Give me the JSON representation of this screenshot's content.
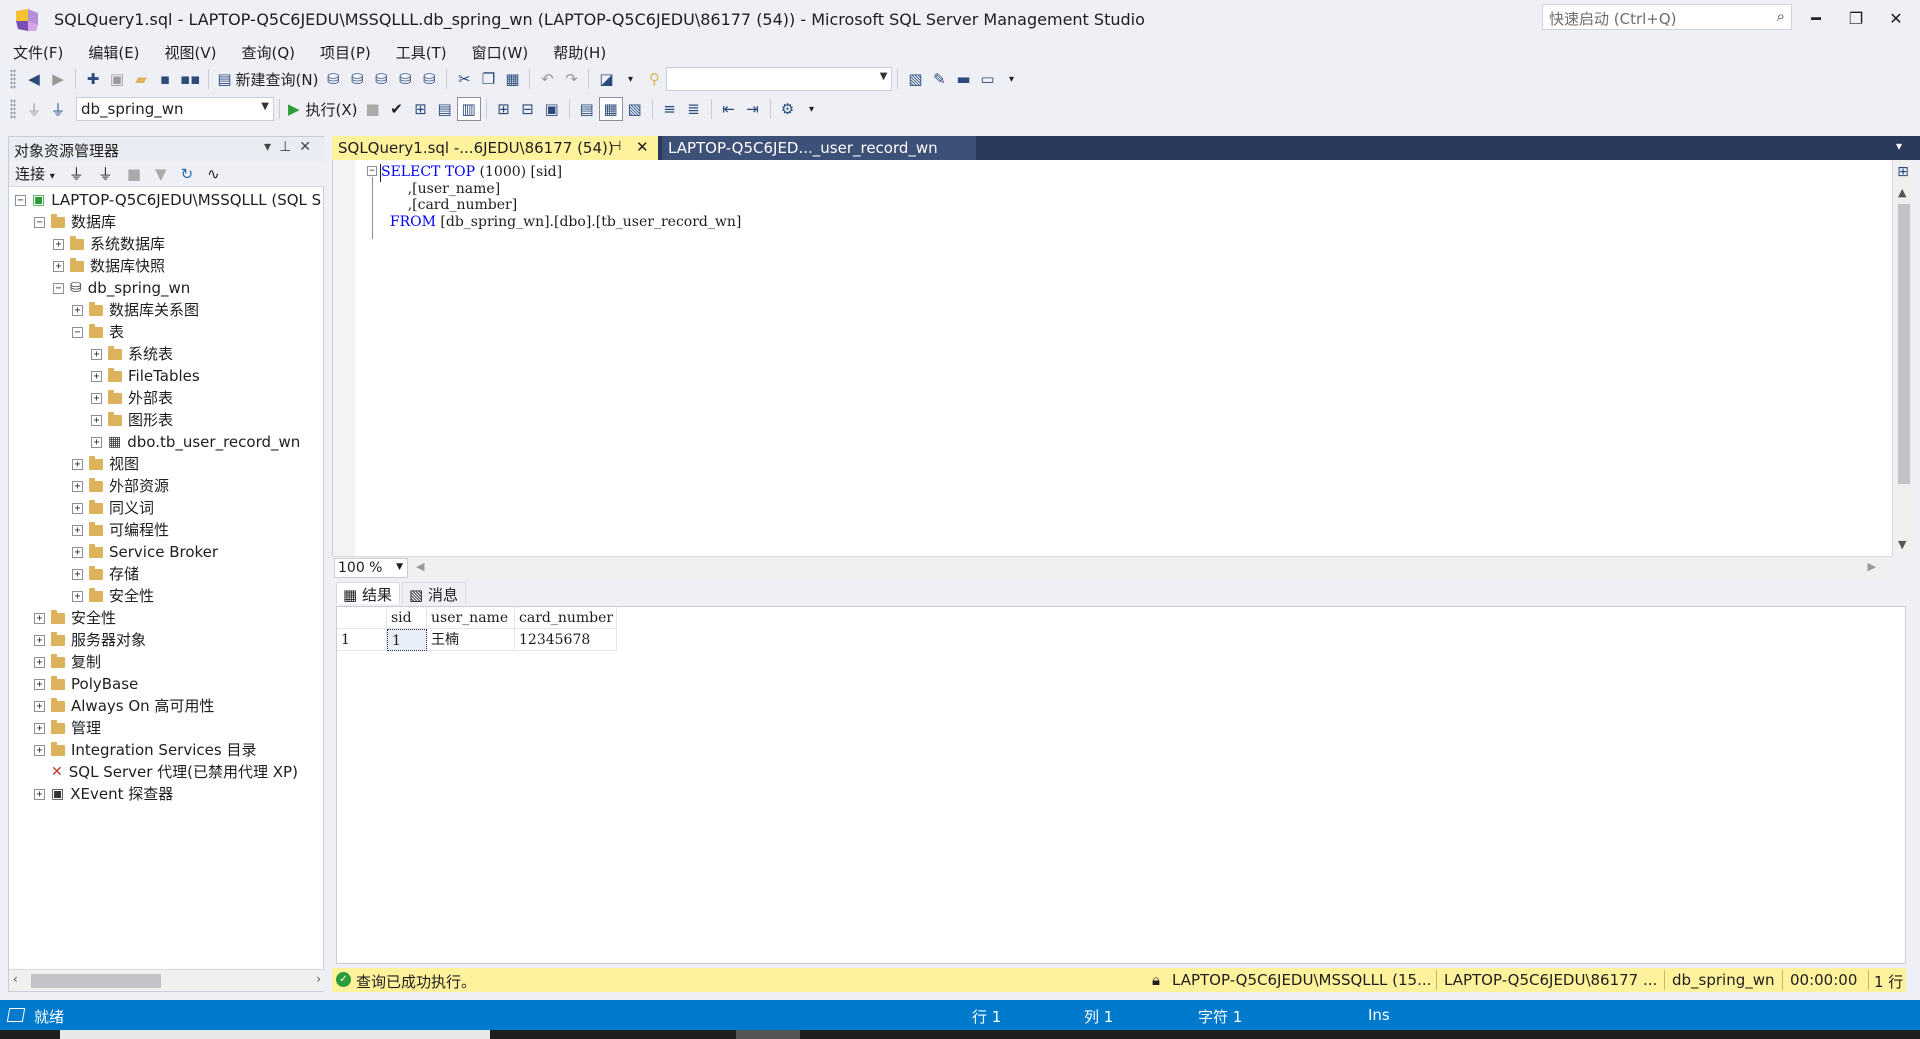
{
  "window": {
    "title": "SQLQuery1.sql - LAPTOP-Q5C6JEDU\\MSSQLLL.db_spring_wn (LAPTOP-Q5C6JEDU\\86177 (54)) - Microsoft SQL Server Management Studio",
    "quick_launch_placeholder": "快速启动 (Ctrl+Q)",
    "minimize": "━",
    "maximize": "❐",
    "close": "✕"
  },
  "menu": [
    "文件(F)",
    "编辑(E)",
    "视图(V)",
    "查询(Q)",
    "项目(P)",
    "工具(T)",
    "窗口(W)",
    "帮助(H)"
  ],
  "toolbar": {
    "new_query": "新建查询(N)",
    "execute": "执行(X)",
    "database": "db_spring_wn"
  },
  "object_explorer": {
    "title": "对象资源管理器",
    "connect": "连接",
    "nodes": [
      {
        "label": "LAPTOP-Q5C6JEDU\\MSSQLLL (SQL S",
        "exp": "−",
        "icon": "server"
      },
      {
        "label": "数据库",
        "exp": "−",
        "icon": "folder"
      },
      {
        "label": "系统数据库",
        "exp": "+",
        "icon": "folder"
      },
      {
        "label": "数据库快照",
        "exp": "+",
        "icon": "folder"
      },
      {
        "label": "db_spring_wn",
        "exp": "−",
        "icon": "database"
      },
      {
        "label": "数据库关系图",
        "exp": "+",
        "icon": "folder"
      },
      {
        "label": "表",
        "exp": "−",
        "icon": "folder"
      },
      {
        "label": "系统表",
        "exp": "+",
        "icon": "folder"
      },
      {
        "label": "FileTables",
        "exp": "+",
        "icon": "folder"
      },
      {
        "label": "外部表",
        "exp": "+",
        "icon": "folder"
      },
      {
        "label": "图形表",
        "exp": "+",
        "icon": "folder"
      },
      {
        "label": "dbo.tb_user_record_wn",
        "exp": "+",
        "icon": "table"
      },
      {
        "label": "视图",
        "exp": "+",
        "icon": "folder"
      },
      {
        "label": "外部资源",
        "exp": "+",
        "icon": "folder"
      },
      {
        "label": "同义词",
        "exp": "+",
        "icon": "folder"
      },
      {
        "label": "可编程性",
        "exp": "+",
        "icon": "folder"
      },
      {
        "label": "Service Broker",
        "exp": "+",
        "icon": "folder"
      },
      {
        "label": "存储",
        "exp": "+",
        "icon": "folder"
      },
      {
        "label": "安全性",
        "exp": "+",
        "icon": "folder"
      },
      {
        "label": "安全性",
        "exp": "+",
        "icon": "folder"
      },
      {
        "label": "服务器对象",
        "exp": "+",
        "icon": "folder"
      },
      {
        "label": "复制",
        "exp": "+",
        "icon": "folder"
      },
      {
        "label": "PolyBase",
        "exp": "+",
        "icon": "folder"
      },
      {
        "label": "Always On 高可用性",
        "exp": "+",
        "icon": "folder"
      },
      {
        "label": "管理",
        "exp": "+",
        "icon": "folder"
      },
      {
        "label": "Integration Services 目录",
        "exp": "+",
        "icon": "folder"
      },
      {
        "label": "SQL Server 代理(已禁用代理 XP)",
        "exp": "",
        "icon": "agent"
      },
      {
        "label": "XEvent 探查器",
        "exp": "+",
        "icon": "xevent"
      }
    ]
  },
  "tabs": {
    "active": "SQLQuery1.sql -...6JEDU\\86177 (54))",
    "inactive": "LAPTOP-Q5C6JED..._user_record_wn"
  },
  "editor": {
    "lines": [
      {
        "kw1": "SELECT",
        "sp1": " ",
        "kw2": "TOP",
        "rest": " (1000) [sid]"
      },
      {
        "kw1": "",
        "sp1": "",
        "kw2": "",
        "rest": "      ,[user_name]"
      },
      {
        "kw1": "",
        "sp1": "",
        "kw2": "",
        "rest": "      ,[card_number]"
      },
      {
        "kw1": "  FROM",
        "sp1": "",
        "kw2": "",
        "rest": " [db_spring_wn].[dbo].[tb_user_record_wn]"
      }
    ]
  },
  "zoom": "100 %",
  "results": {
    "tab_results": "结果",
    "tab_messages": "消息",
    "columns": [
      "sid",
      "user_name",
      "card_number"
    ],
    "rows": [
      {
        "row_no": "1",
        "cells": [
          "1",
          "王楠",
          "12345678"
        ]
      }
    ]
  },
  "query_status": {
    "message": "查询已成功执行。",
    "server": "LAPTOP-Q5C6JEDU\\MSSQLLL (15...",
    "user": "LAPTOP-Q5C6JEDU\\86177 ...",
    "database": "db_spring_wn",
    "time": "00:00:00",
    "rows": "1 行"
  },
  "status_bar": {
    "state": "就绪",
    "line": "行 1",
    "col": "列 1",
    "char": "字符 1",
    "mode": "Ins"
  }
}
